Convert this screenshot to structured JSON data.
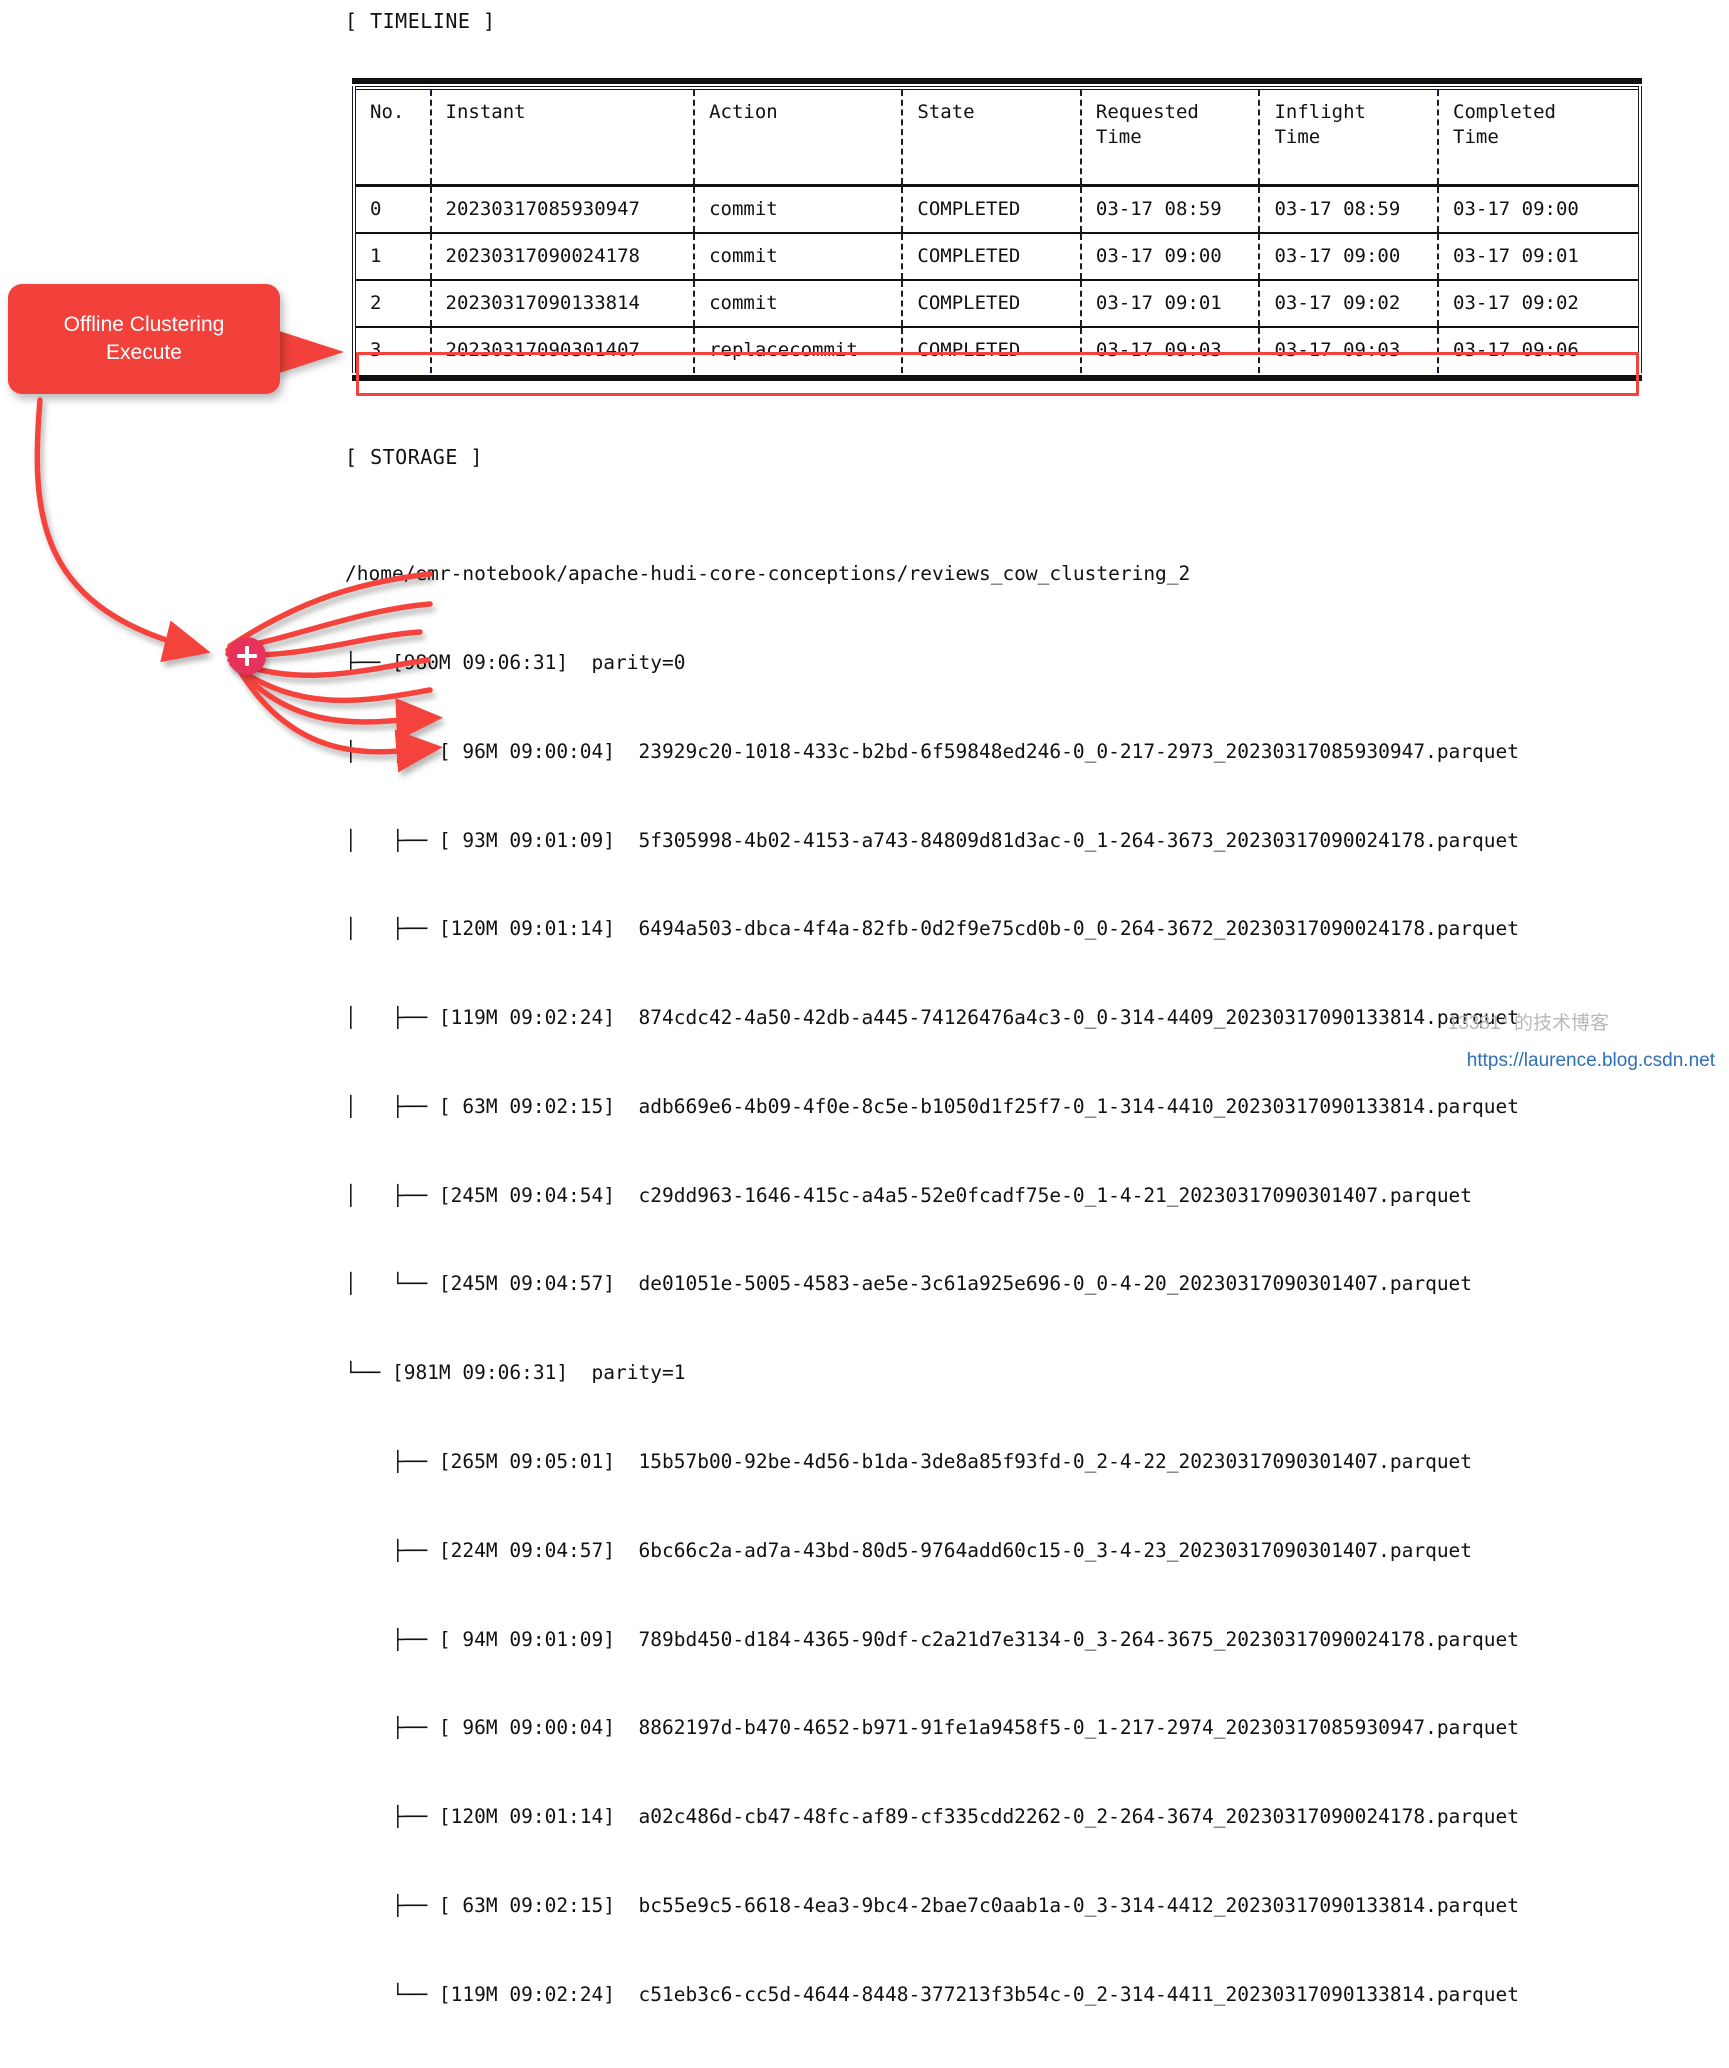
{
  "sections": {
    "timeline_label": "[ TIMELINE ]",
    "storage_label": "[ STORAGE ]"
  },
  "callout": {
    "text": "Offline Clustering\nExecute",
    "color": "#f2403a"
  },
  "highlight": {
    "color": "#f4423c",
    "row_index": 3
  },
  "timeline_table": {
    "columns": [
      "No.",
      "Instant",
      "Action",
      "State",
      "Requested\nTime",
      "Inflight\nTime",
      "Completed\nTime"
    ],
    "rows": [
      [
        "0",
        "20230317085930947",
        "commit",
        "COMPLETED",
        "03-17 08:59",
        "03-17 08:59",
        "03-17 09:00"
      ],
      [
        "1",
        "20230317090024178",
        "commit",
        "COMPLETED",
        "03-17 09:00",
        "03-17 09:00",
        "03-17 09:01"
      ],
      [
        "2",
        "20230317090133814",
        "commit",
        "COMPLETED",
        "03-17 09:01",
        "03-17 09:02",
        "03-17 09:02"
      ],
      [
        "3",
        "20230317090301407",
        "replacecommit",
        "COMPLETED",
        "03-17 09:03",
        "03-17 09:03",
        "03-17 09:06"
      ]
    ]
  },
  "storage": {
    "root_path": "/home/emr-notebook/apache-hudi-core-conceptions/reviews_cow_clustering_2",
    "lines": [
      "/home/emr-notebook/apache-hudi-core-conceptions/reviews_cow_clustering_2",
      "├── [980M 09:06:31]  parity=0",
      "│   ├── [ 96M 09:00:04]  23929c20-1018-433c-b2bd-6f59848ed246-0_0-217-2973_20230317085930947.parquet",
      "│   ├── [ 93M 09:01:09]  5f305998-4b02-4153-a743-84809d81d3ac-0_1-264-3673_20230317090024178.parquet",
      "│   ├── [120M 09:01:14]  6494a503-dbca-4f4a-82fb-0d2f9e75cd0b-0_0-264-3672_20230317090024178.parquet",
      "│   ├── [119M 09:02:24]  874cdc42-4a50-42db-a445-74126476a4c3-0_0-314-4409_20230317090133814.parquet",
      "│   ├── [ 63M 09:02:15]  adb669e6-4b09-4f0e-8c5e-b1050d1f25f7-0_1-314-4410_20230317090133814.parquet",
      "│   ├── [245M 09:04:54]  c29dd963-1646-415c-a4a5-52e0fcadf75e-0_1-4-21_20230317090301407.parquet",
      "│   └── [245M 09:04:57]  de01051e-5005-4583-ae5e-3c61a925e696-0_0-4-20_20230317090301407.parquet",
      "└── [981M 09:06:31]  parity=1",
      "    ├── [265M 09:05:01]  15b57b00-92be-4d56-b1da-3de8a85f93fd-0_2-4-22_20230317090301407.parquet",
      "    ├── [224M 09:04:57]  6bc66c2a-ad7a-43bd-80d5-9764add60c15-0_3-4-23_20230317090301407.parquet",
      "    ├── [ 94M 09:01:09]  789bd450-d184-4365-90df-c2a21d7e3134-0_3-264-3675_20230317090024178.parquet",
      "    ├── [ 96M 09:00:04]  8862197d-b470-4652-b971-91fe1a9458f5-0_1-217-2974_20230317085930947.parquet",
      "    ├── [120M 09:01:14]  a02c486d-cb47-48fc-af89-cf335cdd2262-0_2-264-3674_20230317090024178.parquet",
      "    ├── [ 63M 09:02:15]  bc55e9c5-6618-4ea3-9bc4-2bae7c0aab1a-0_3-314-4412_20230317090133814.parquet",
      "    └── [119M 09:02:24]  c51eb3c6-cc5d-4644-8448-377213f3b54c-0_2-314-4411_20230317090133814.parquet"
    ]
  },
  "annotations": {
    "merge_node_icon": "plus-circle-icon",
    "arrow_color": "#f4423c"
  },
  "watermarks": {
    "blog_url": "https://laurence.blog.csdn.net",
    "cn_text": "13381⁴ 的技术博客"
  }
}
